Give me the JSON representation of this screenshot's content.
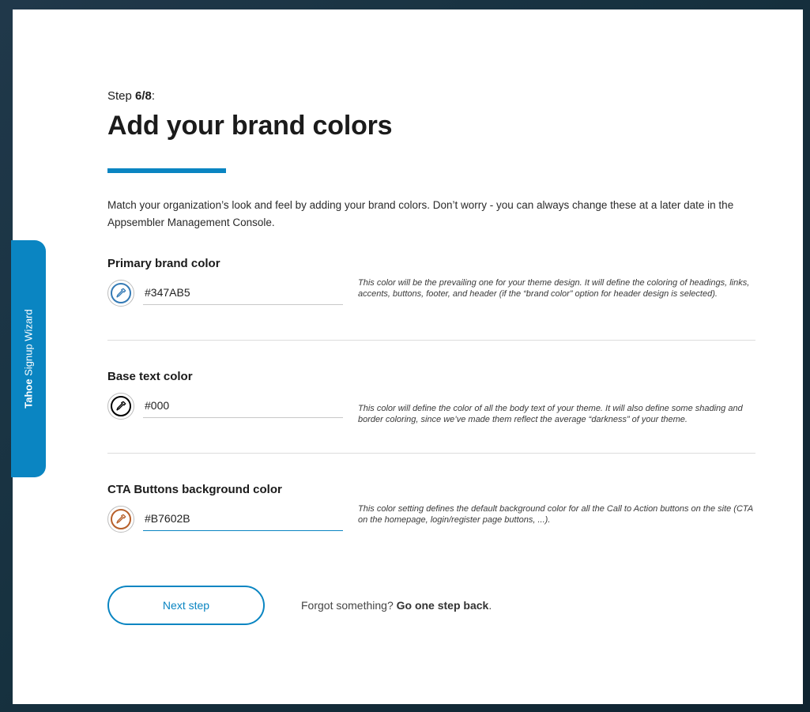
{
  "side_tab": {
    "bold": "Tahoe",
    "rest": " Signup Wizard"
  },
  "step": {
    "prefix": "Step ",
    "current": "6/8",
    "suffix": ":"
  },
  "title": "Add your brand colors",
  "intro": "Match your organization’s look and feel by adding your brand colors. Don’t worry - you can always change these at a later date in the Appsembler Management Console.",
  "colors": [
    {
      "label": "Primary brand color",
      "value": "#347AB5",
      "swatch_color": "#347AB5",
      "hint": "This color will be the prevailing one for your theme design. It will define the coloring of headings, links, accents, buttons, footer, and header (if the “brand color” option for header design is selected)."
    },
    {
      "label": "Base text color",
      "value": "#000",
      "swatch_color": "#000000",
      "hint": "This color will define the color of all the body text of your theme. It will also define some shading and border coloring, since we’ve made them reflect the average “darkness” of your theme."
    },
    {
      "label": "CTA Buttons background color",
      "value": "#B7602B",
      "swatch_color": "#B7602B",
      "hint": "This color setting defines the default background color for all the Call to Action buttons on the site (CTA on the homepage, login/register page buttons, ...)."
    }
  ],
  "footer": {
    "next_label": "Next step",
    "back_prefix": "Forgot something? ",
    "back_link": "Go one step back",
    "back_suffix": "."
  },
  "accent_color": "#0A85C2"
}
